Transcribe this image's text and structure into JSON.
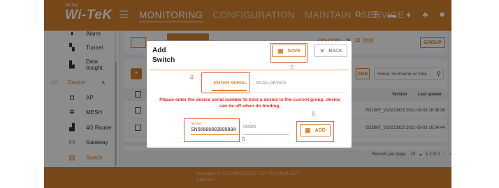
{
  "app": {
    "logo": "Wi-TeK",
    "logo_small": "Wi-Tek"
  },
  "nav": {
    "monitoring": "MONITORING",
    "configuration": "CONFIGURATION",
    "maintain": "MAINTAIN",
    "service": "SERVICE"
  },
  "sidebar": {
    "alarm": "Alarm",
    "tunnel": "Tunnel",
    "data_insight": "Data Insight",
    "device": "Device",
    "ap": "AP",
    "mesh": "MESH",
    "router": "4G Router",
    "gateway": "Gateway",
    "switch": "Switch"
  },
  "background": {
    "breadcrumb_email": "...qq.com",
    "breadcrumb_sep": ">",
    "breadcrumb_group": "test",
    "group_button": "GROUP",
    "search_placeholder": "Serial, hostname or note",
    "search_tag": "ADE",
    "col_version": "Version",
    "col_last_update": "Last update",
    "row1_version": "I53100F_V10210823",
    "row1_update": "2021-09-03 16:06:36",
    "row2_version": "I53280F_V10210823",
    "row2_update": "2021-09-03 16:04:44",
    "records_label": "Records per page:",
    "records_value": "10",
    "range": "1-2 of 2"
  },
  "modal": {
    "title_line1": "Add",
    "title_line2": "Switch",
    "save_label": "SAVE",
    "back_label": "BACK",
    "tab_enter_serial": "ENTER SERIAL",
    "tab_scan_device": "SCAN DEVICE",
    "warning": "Please enter the device serial number to bind a device to the current group, device can be off when do binding.",
    "serial_label": "Serial",
    "serial_value": "SN5668888389988A",
    "notes_placeholder": "Notes",
    "add_label": "ADD"
  },
  "annotations": {
    "n4": "4",
    "n5": "5",
    "n6": "6",
    "n7": "7"
  },
  "footer": {
    "line1": "Copyright © 2021 WIRELESS-TEK TECHNOLOGY",
    "line2": "LIMITED"
  },
  "colors": {
    "brand": "#d8822f",
    "warning": "#e0301e",
    "annotation": "#e36a50"
  }
}
